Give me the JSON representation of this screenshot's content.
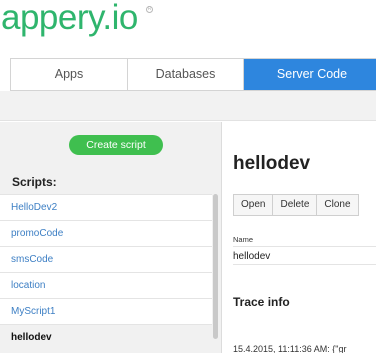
{
  "logo": {
    "text": "appery.io",
    "reg_mark": "R"
  },
  "tabs": [
    {
      "label": "Apps"
    },
    {
      "label": "Databases"
    },
    {
      "label": "Server Code",
      "active": true
    }
  ],
  "sidebar": {
    "create_button": "Create script",
    "scripts_label": "Scripts:",
    "items": [
      {
        "label": "HelloDev2"
      },
      {
        "label": "promoCode"
      },
      {
        "label": "smsCode"
      },
      {
        "label": "location"
      },
      {
        "label": "MyScript1"
      },
      {
        "label": "hellodev",
        "selected": true
      }
    ]
  },
  "main": {
    "title": "hellodev",
    "buttons": [
      {
        "label": "Open"
      },
      {
        "label": "Delete"
      },
      {
        "label": "Clone"
      }
    ],
    "name_label": "Name",
    "name_value": "hellodev",
    "trace_heading": "Trace info",
    "trace_line": "15.4.2015, 11:11:36 AM: {\"gr"
  },
  "colors": {
    "brand_green": "#2fb56d",
    "active_tab": "#2e86de",
    "create_button": "#3fbf4f",
    "link": "#3d7fc4"
  }
}
